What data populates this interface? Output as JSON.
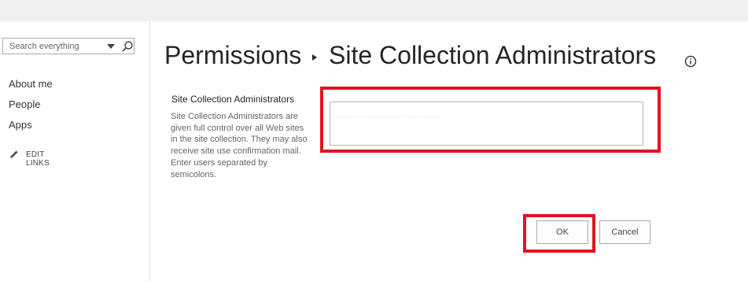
{
  "nav": {
    "search": {
      "placeholder": "Search everything"
    },
    "items": [
      {
        "label": "About me"
      },
      {
        "label": "People"
      },
      {
        "label": "Apps"
      }
    ],
    "edit_links": "EDIT LINKS"
  },
  "header": {
    "crumb_parent": "Permissions",
    "crumb_current": "Site Collection Administrators",
    "info_icon": "info-icon"
  },
  "section": {
    "title": "Site Collection Administrators",
    "description": "Site Collection Administrators are given full control over all Web sites in the site collection. They may also receive site use confirmation mail. Enter users separated by semicolons.",
    "people_picker_value": "........  ..............  ....  ......."
  },
  "buttons": {
    "ok": "OK",
    "cancel": "Cancel"
  },
  "colors": {
    "highlight": "#e0161e",
    "title_text": "#262626",
    "top_bar": "#f0f0f0"
  }
}
